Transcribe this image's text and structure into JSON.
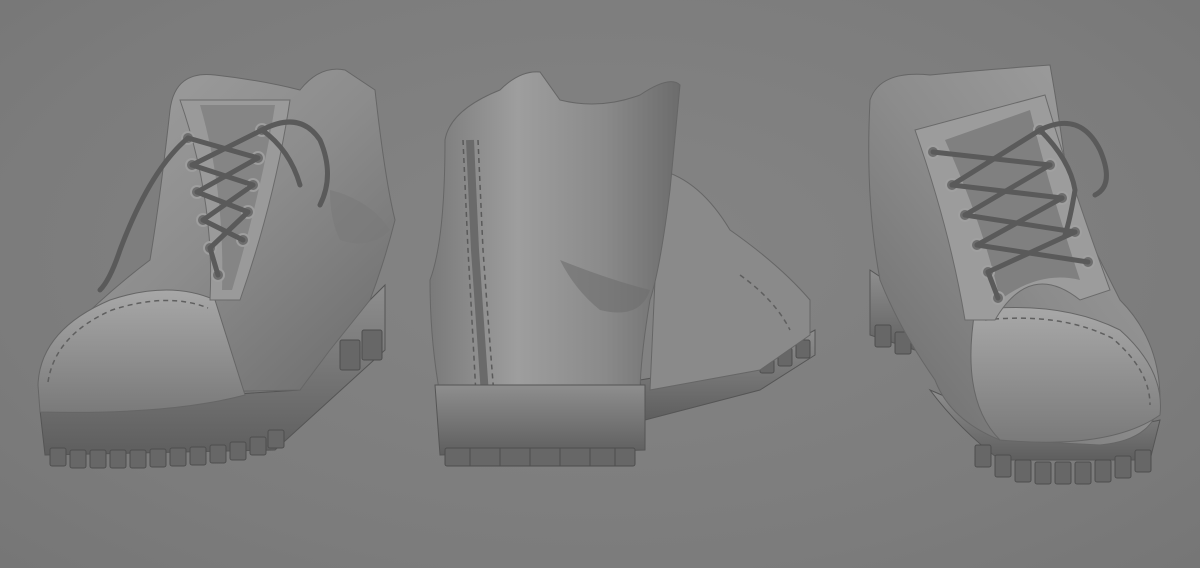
{
  "scene": {
    "background_color": "#7f7f7f",
    "model_color": "#8a8a8a",
    "views": [
      {
        "id": "front-left",
        "icon": "boot-icon"
      },
      {
        "id": "back",
        "icon": "boot-icon"
      },
      {
        "id": "front-right",
        "icon": "boot-icon"
      }
    ]
  }
}
